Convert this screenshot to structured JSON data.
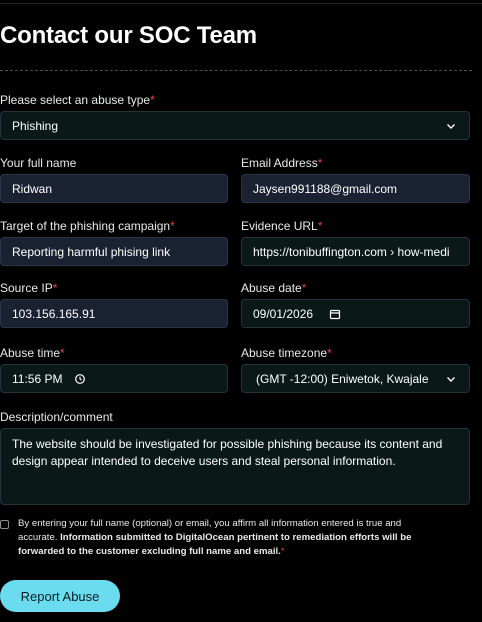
{
  "form": {
    "title": "Contact our SOC Team",
    "abuse_type": {
      "label": "Please select an abuse type",
      "value": "Phishing"
    },
    "full_name": {
      "label": "Your full name",
      "value": "Ridwan"
    },
    "email": {
      "label": "Email Address",
      "value": "Jaysen991188@gmail.com"
    },
    "target": {
      "label": "Target of the phishing campaign",
      "value": "Reporting harmful phising link"
    },
    "evidence_url": {
      "label": "Evidence URL",
      "value": "https://tonibuffington.com › how-medi"
    },
    "source_ip": {
      "label": "Source IP",
      "value": "103.156.165.91"
    },
    "abuse_date": {
      "label": "Abuse date",
      "value": "09/01/2026"
    },
    "abuse_time": {
      "label": "Abuse time",
      "value": "11:56 PM"
    },
    "abuse_timezone": {
      "label": "Abuse timezone",
      "value": "(GMT -12:00) Eniwetok, Kwajale"
    },
    "description": {
      "label": "Description/comment",
      "value": "The website should be investigated for possible phishing because its content and design appear intended to deceive users and steal personal information."
    },
    "consent": {
      "text": "By entering your full name (optional) or email, you affirm all information entered is true and accurate.",
      "bold_text": "Information submitted to DigitalOcean pertinent to remediation efforts will be forwarded to the customer excluding full name and email.",
      "required_mark": "*"
    },
    "submit_label": "Report Abuse",
    "required_mark": "*"
  },
  "colors": {
    "background": "#000000",
    "field_bg": "#0a1818",
    "filled_field_bg": "#1a2232",
    "required": "#e0484a",
    "button": "#6bdcf0"
  },
  "icons": [
    "chevron-down-icon",
    "calendar-icon",
    "clock-icon"
  ]
}
